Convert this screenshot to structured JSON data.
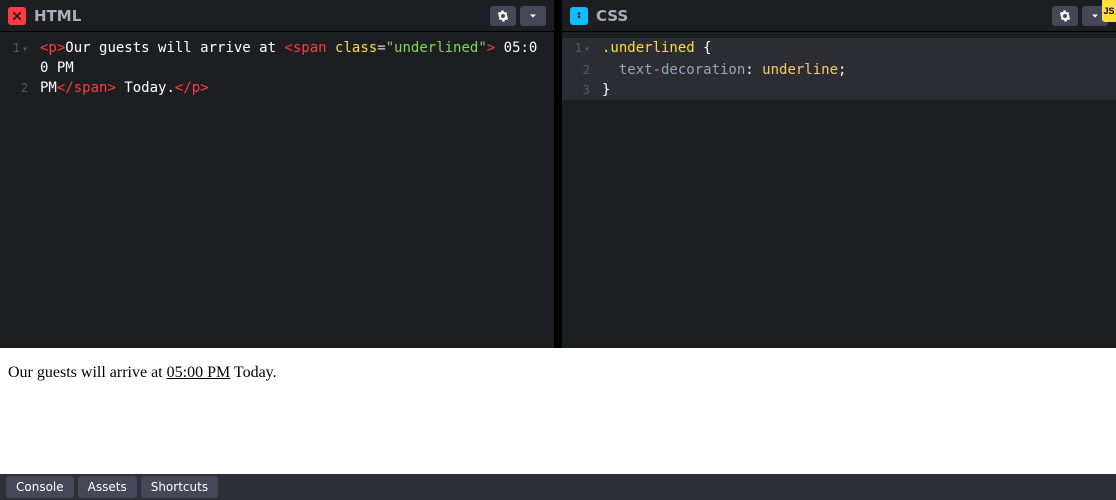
{
  "htmlPanel": {
    "title": "HTML",
    "lines": {
      "n1": "1",
      "n2": "2"
    },
    "code": {
      "open_p": "<p>",
      "t1": "Our guests will arrive at ",
      "open_span": "<span",
      "attr_name": " class",
      "eq": "=",
      "attr_val": "\"underlined\"",
      "gt": ">",
      "t_time": " 05:00 PM",
      "close_span": "</span>",
      "t2": " Today.",
      "close_p": "</p>"
    }
  },
  "cssPanel": {
    "title": "CSS",
    "lines": {
      "n1": "1",
      "n2": "2",
      "n3": "3"
    },
    "code": {
      "selector": ".underlined",
      "ob": " {",
      "indent": "  ",
      "prop": "text-decoration",
      "colon": ": ",
      "val": "underline",
      "semi": ";",
      "cb": "}"
    }
  },
  "output": {
    "before": "Our guests will arrive at ",
    "underlined": "05:00 PM",
    "after": " Today."
  },
  "footer": {
    "console": "Console",
    "assets": "Assets",
    "shortcuts": "Shortcuts"
  },
  "sideTab": "JS"
}
